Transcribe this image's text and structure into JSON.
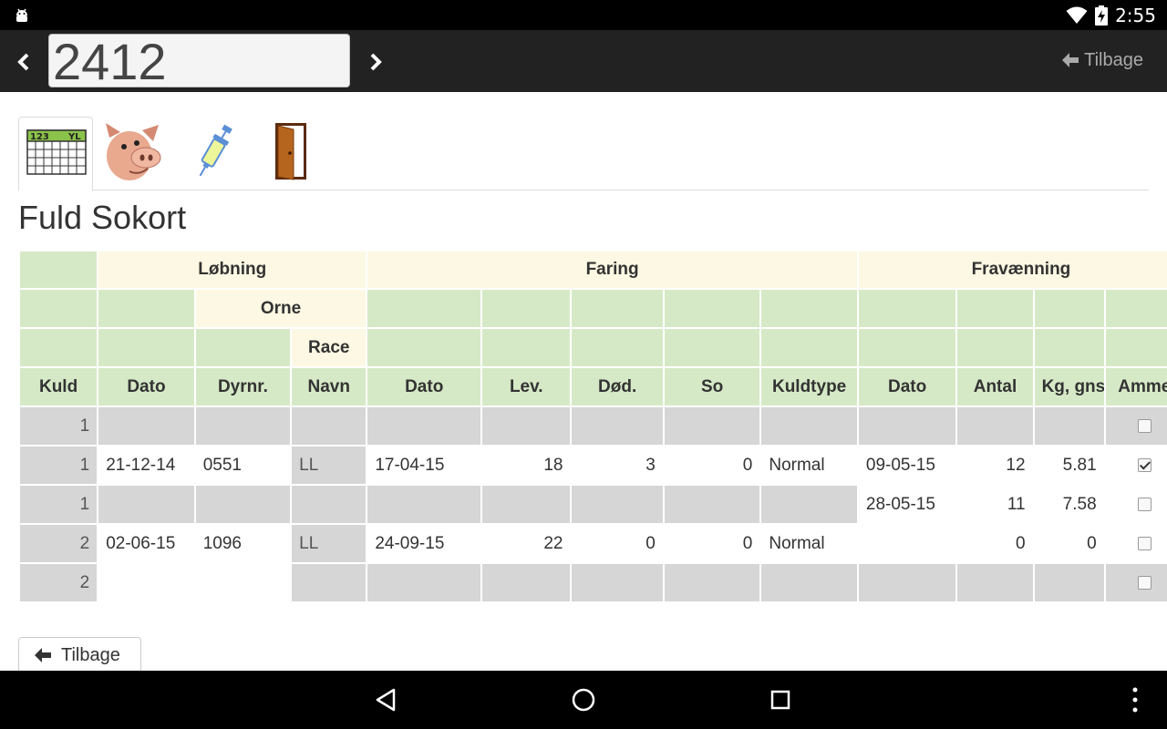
{
  "status_bar": {
    "time": "2:55"
  },
  "header": {
    "animal_number": "2412",
    "back_label": "Tilbage"
  },
  "tabs": [
    {
      "icon": "calendar-icon",
      "calendar_left": "123",
      "calendar_right": "YL",
      "active": true
    },
    {
      "icon": "pig-icon",
      "active": false
    },
    {
      "icon": "syringe-icon",
      "active": false
    },
    {
      "icon": "door-icon",
      "active": false
    }
  ],
  "page_title": "Fuld Sokort",
  "table": {
    "groups": {
      "lobning": "Løbning",
      "faring": "Faring",
      "fravaenning": "Fravænning"
    },
    "subgroups": {
      "orne": "Orne",
      "race": "Race"
    },
    "columns": [
      "Kuld",
      "Dato",
      "Dyrnr.",
      "Navn",
      "Dato",
      "Lev.",
      "Død.",
      "So",
      "Kuldtype",
      "Dato",
      "Antal",
      "Kg, gns",
      "Amme"
    ],
    "rows": [
      {
        "kuld": "1",
        "lob_dato": "",
        "dyrnr": "",
        "navn": "",
        "far_dato": "",
        "lev": "",
        "dod": "",
        "so": "",
        "kuldtype": "",
        "frav_dato": "",
        "antal": "",
        "kg": "",
        "amme": false
      },
      {
        "kuld": "1",
        "lob_dato": "21-12-14",
        "dyrnr": "0551",
        "navn": "LL",
        "far_dato": "17-04-15",
        "lev": "18",
        "dod": "3",
        "so": "0",
        "kuldtype": "Normal",
        "frav_dato": "09-05-15",
        "antal": "12",
        "kg": "5.81",
        "amme": true
      },
      {
        "kuld": "1",
        "lob_dato": "",
        "dyrnr": "",
        "navn": "",
        "far_dato": "",
        "lev": "",
        "dod": "",
        "so": "",
        "kuldtype": "",
        "frav_dato": "28-05-15",
        "antal": "11",
        "kg": "7.58",
        "amme": false
      },
      {
        "kuld": "2",
        "lob_dato": "02-06-15",
        "dyrnr": "1096",
        "navn": "LL",
        "far_dato": "24-09-15",
        "lev": "22",
        "dod": "0",
        "so": "0",
        "kuldtype": "Normal",
        "frav_dato": "",
        "antal": "0",
        "kg": "0",
        "amme": false
      },
      {
        "kuld": "2",
        "lob_dato": "",
        "dyrnr": "",
        "navn": "",
        "far_dato": "",
        "lev": "",
        "dod": "",
        "so": "",
        "kuldtype": "",
        "frav_dato": "",
        "antal": "",
        "kg": "",
        "amme": false
      }
    ]
  },
  "footer": {
    "back_label": "Tilbage"
  }
}
